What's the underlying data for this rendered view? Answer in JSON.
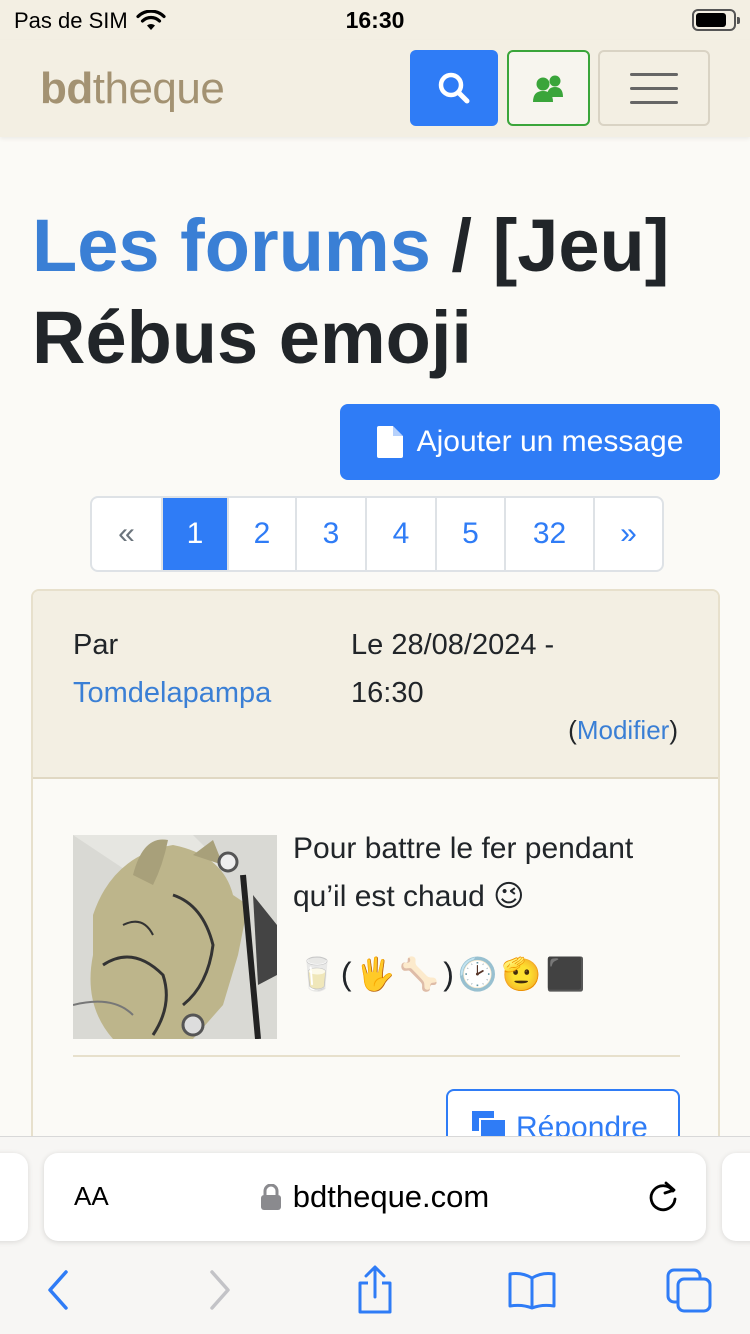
{
  "status_bar": {
    "carrier": "Pas de SIM",
    "time": "16:30"
  },
  "navbar": {
    "brand_bold": "bd",
    "brand_rest": "theque"
  },
  "page": {
    "breadcrumb_link": "Les forums",
    "separator": " / ",
    "topic_title": "[Jeu] Rébus emoji",
    "add_message_label": "Ajouter un message"
  },
  "pagination": {
    "prev": "«",
    "pages": [
      "1",
      "2",
      "3",
      "4",
      "5",
      "32"
    ],
    "active": "1",
    "next": "»"
  },
  "post": {
    "by_label": "Par",
    "author": "Tomdelapampa",
    "date_line1": "Le 28/08/2024 -",
    "date_line2": "16:30",
    "modify_open": "(",
    "modify_label": "Modifier",
    "modify_close": ")",
    "text": "Pour battre le fer pendant qu’il est chaud 😉",
    "emoji_rebus": [
      "🥛",
      "(",
      "🖐",
      "🦴",
      ")",
      "🕑",
      "🫡",
      "⬛"
    ],
    "reply_label": "Répondre"
  },
  "safari": {
    "text_size_label": "AA",
    "url": "bdtheque.com"
  },
  "colors": {
    "primary": "#2f7cf6",
    "link": "#3a7fd5",
    "brand": "#a39272",
    "header_bg": "#f3efe3",
    "success": "#3aa53a"
  }
}
